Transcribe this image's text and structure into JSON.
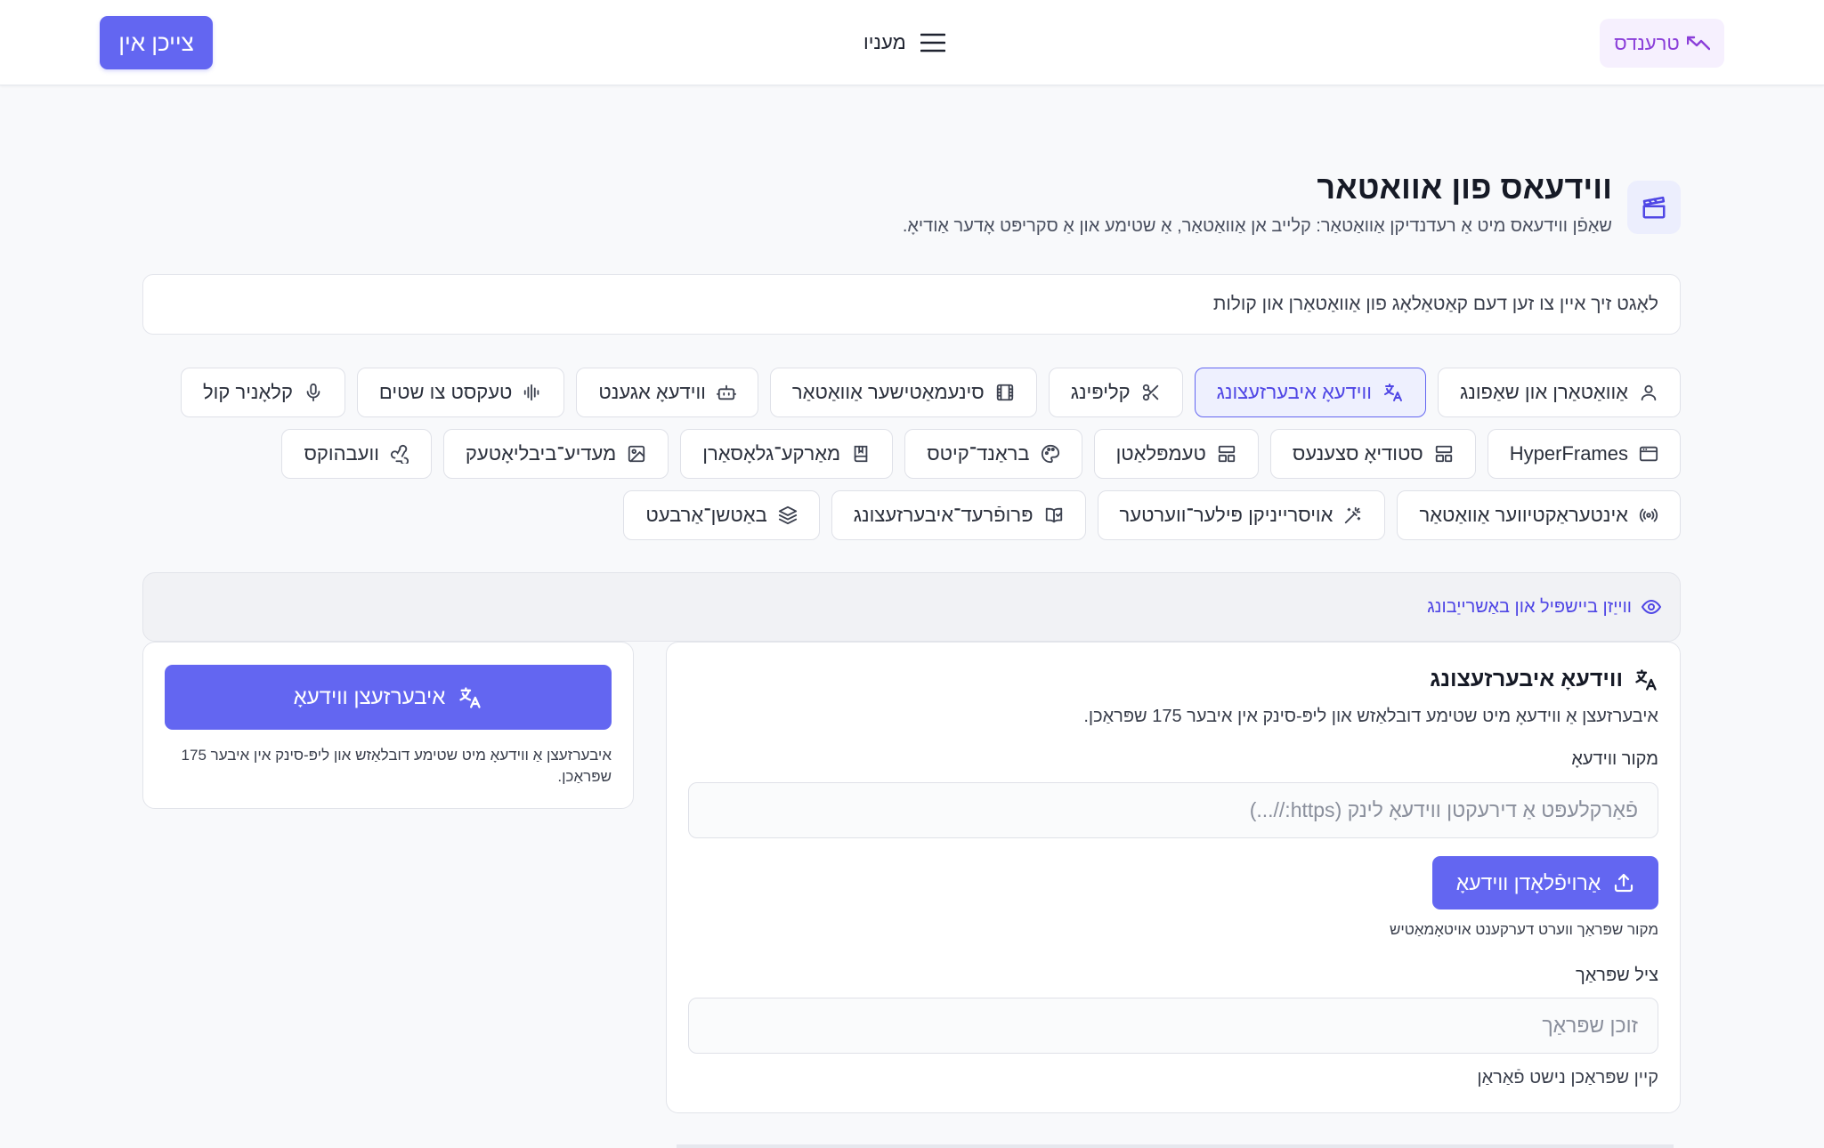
{
  "header": {
    "signin_label": "צייכן אין",
    "menu_label": "מעניו",
    "trends_label": "טרענדס"
  },
  "page": {
    "title": "ווידעאס פון אוואטאר",
    "subtitle": "שאַפֿן ווידעאס מיט אַ רעדנדיקן אַוואַטאַר: קלייב אן אַוואַטאַר, אַ שטימע און אַ סקריפּט אָדער אַודיאָ."
  },
  "search": {
    "placeholder": "לאָגט זיך איין צו זען דעם קאַטאַלאָג פון אַוואַטאַרן און קולות"
  },
  "chips": {
    "row1": [
      {
        "label": "אַוואַטאַרן און שאַפונג",
        "icon": "user-icon"
      },
      {
        "label": "ווידעאָ איבערזעצונג",
        "icon": "translate-icon",
        "active": true
      },
      {
        "label": "קליפּינג",
        "icon": "scissors-icon"
      },
      {
        "label": "סינעמאַטישער אַוואַטאַר",
        "icon": "film-icon"
      },
      {
        "label": "ווידעאָ אגענט",
        "icon": "robot-icon"
      },
      {
        "label": "טעקסט צו שטים",
        "icon": "audio-waveform-icon"
      },
      {
        "label": "קלאָניר קול",
        "icon": "microphone-icon"
      }
    ],
    "row2": [
      {
        "label": "HyperFrames",
        "icon": "browser-window-icon"
      },
      {
        "label": "סטודיאָ סצענעס",
        "icon": "layout-icon"
      },
      {
        "label": "טעמפּלאַטן",
        "icon": "template-icon"
      },
      {
        "label": "בראַנד־קיטס",
        "icon": "palette-icon"
      },
      {
        "label": "מאַרקע־גלאָסאַרן",
        "icon": "book-icon"
      },
      {
        "label": "מעדיע־ביבליאָטעק",
        "icon": "image-icon"
      },
      {
        "label": "וועבהוקס",
        "icon": "webhook-icon"
      }
    ],
    "row3": [
      {
        "label": "אינטעראַקטיווער אַוואַטאַר",
        "icon": "broadcast-icon"
      },
      {
        "label": "אויסרייניקן פּילער־ווערטער",
        "icon": "magic-wand-icon"
      },
      {
        "label": "פּרופֿרעד־איבערזעצונג",
        "icon": "book-open-check-icon"
      },
      {
        "label": "באַטשן־אַרבעט",
        "icon": "layers-icon"
      }
    ]
  },
  "preview": {
    "label": "ווייַזן ביישפּיל און באַשרייַבונג"
  },
  "form": {
    "title": "ווידעאָ איבערזעצונג",
    "description": "איבערזעצן אַ ווידעאָ מיט שטימע דובלאַזש און ליפּ-סינק אין איבער 175 שפּראַכן.",
    "source_label": "מקור ווידעאָ",
    "source_placeholder": "פֿאַרקלעפּט אַ דירעקטן ווידעאָ לינק (https://...)",
    "upload_label": "אַרויפֿלאָדן ווידעאָ",
    "source_hint": "מקור שפּראַך ווערט דערקענט אויטאָמאַטיש",
    "target_label": "ציל שפּראַך",
    "target_placeholder": "זוכן שפּראַך",
    "target_hint": "קיין שפּראַכן נישט פֿאַראַן"
  },
  "side": {
    "translate_label": "איבערזעצן ווידעאָ",
    "description": "איבערזעצן אַ ווידעאָ מיט שטימע דובלאַזש און ליפּ-סינק אין איבער 175 שפּראַכן."
  },
  "colors": {
    "accent": "#6366f1",
    "accent_text": "#4f46e5",
    "trends": "#8b3fd9"
  }
}
